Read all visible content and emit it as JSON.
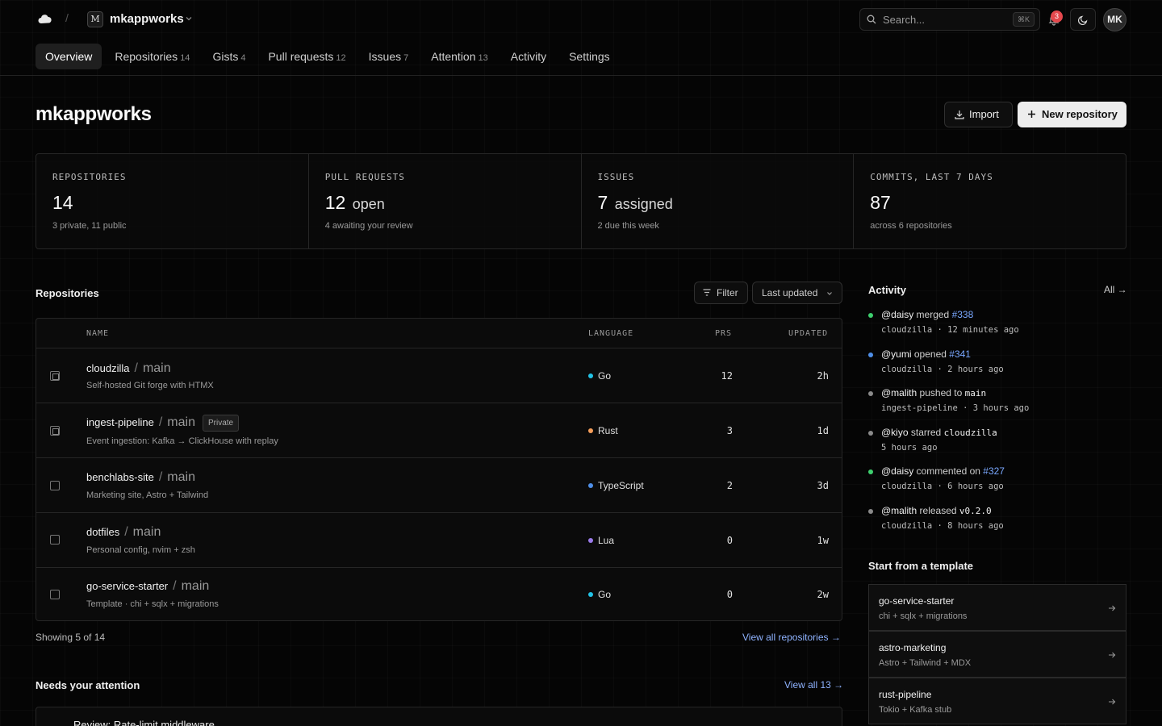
{
  "topbar": {
    "slash": "/",
    "org_initial": "M",
    "org_name": "mkappworks",
    "search_placeholder": "Search...",
    "search_shortcut": "⌘K",
    "notification_count": "3",
    "user_initials": "MK"
  },
  "tabs": [
    {
      "label": "Overview",
      "count": ""
    },
    {
      "label": "Repositories",
      "count": "14"
    },
    {
      "label": "Gists",
      "count": "4"
    },
    {
      "label": "Pull requests",
      "count": "12"
    },
    {
      "label": "Issues",
      "count": "7"
    },
    {
      "label": "Attention",
      "count": "13"
    },
    {
      "label": "Activity",
      "count": ""
    },
    {
      "label": "Settings",
      "count": ""
    }
  ],
  "header": {
    "title": "mkappworks",
    "import_label": "Import",
    "new_repo_label": "New repository"
  },
  "stats": [
    {
      "label": "REPOSITORIES",
      "value": "14",
      "suffix": "",
      "sub": "3 private, 11 public"
    },
    {
      "label": "PULL REQUESTS",
      "value": "12",
      "suffix": "open",
      "sub": "4 awaiting your review"
    },
    {
      "label": "ISSUES",
      "value": "7",
      "suffix": "assigned",
      "sub": "2 due this week"
    },
    {
      "label": "COMMITS, LAST 7 DAYS",
      "value": "87",
      "suffix": "",
      "sub": "across 6 repositories"
    }
  ],
  "repositories": {
    "title": "Repositories",
    "filter_label": "Filter",
    "sort_label": "Last updated",
    "columns": [
      "NAME",
      "LANGUAGE",
      "PRS",
      "UPDATED"
    ],
    "rows": [
      {
        "name": "cloudzilla",
        "branch": "main",
        "badge": "",
        "desc": "Self-hosted Git forge with HTMX",
        "language": "Go",
        "lang_color": "#22c3e6",
        "prs": "12",
        "updated": "2h",
        "check": "indeterminate"
      },
      {
        "name": "ingest-pipeline",
        "branch": "main",
        "badge": "Private",
        "desc": "Event ingestion: Kafka → ClickHouse with replay",
        "language": "Rust",
        "lang_color": "#f59e5b",
        "prs": "3",
        "updated": "1d",
        "check": "indeterminate"
      },
      {
        "name": "benchlabs-site",
        "branch": "main",
        "badge": "",
        "desc": "Marketing site, Astro + Tailwind",
        "language": "TypeScript",
        "lang_color": "#4f8fe8",
        "prs": "2",
        "updated": "3d",
        "check": "unchecked"
      },
      {
        "name": "dotfiles",
        "branch": "main",
        "badge": "",
        "desc": "Personal config, nvim + zsh",
        "language": "Lua",
        "lang_color": "#9b7bea",
        "prs": "0",
        "updated": "1w",
        "check": "unchecked"
      },
      {
        "name": "go-service-starter",
        "branch": "main",
        "badge": "",
        "desc": "Template · chi + sqlx + migrations",
        "language": "Go",
        "lang_color": "#22c3e6",
        "prs": "0",
        "updated": "2w",
        "check": "unchecked"
      }
    ],
    "showing": "Showing 5 of 14",
    "view_all": "View all repositories →"
  },
  "attention": {
    "title": "Needs your attention",
    "view_all": "View all 13 →",
    "first_item": "Review: Rate-limit middleware"
  },
  "activity": {
    "title": "Activity",
    "all_link": "All →",
    "items": [
      {
        "dot": "#3ecf6e",
        "user": "@daisy",
        "verb": "merged",
        "ref": "#338",
        "code": "",
        "meta": "cloudzilla · 12 minutes ago"
      },
      {
        "dot": "#4f8fe8",
        "user": "@yumi",
        "verb": "opened",
        "ref": "#341",
        "code": "",
        "meta": "cloudzilla · 2 hours ago"
      },
      {
        "dot": "#8a8a8a",
        "user": "@malith",
        "verb": "pushed to",
        "ref": "",
        "code": "main",
        "meta": "ingest-pipeline · 3 hours ago"
      },
      {
        "dot": "#8a8a8a",
        "user": "@kiyo",
        "verb": "starred",
        "ref": "",
        "code": "cloudzilla",
        "meta": "5 hours ago"
      },
      {
        "dot": "#3ecf6e",
        "user": "@daisy",
        "verb": "commented on",
        "ref": "#327",
        "code": "",
        "meta": "cloudzilla · 6 hours ago"
      },
      {
        "dot": "#8a8a8a",
        "user": "@malith",
        "verb": "released",
        "ref": "",
        "code": "v0.2.0",
        "meta": "cloudzilla · 8 hours ago"
      }
    ]
  },
  "templates": {
    "title": "Start from a template",
    "items": [
      {
        "name": "go-service-starter",
        "desc": "chi + sqlx + migrations"
      },
      {
        "name": "astro-marketing",
        "desc": "Astro + Tailwind + MDX"
      },
      {
        "name": "rust-pipeline",
        "desc": "Tokio + Kafka stub"
      }
    ]
  }
}
